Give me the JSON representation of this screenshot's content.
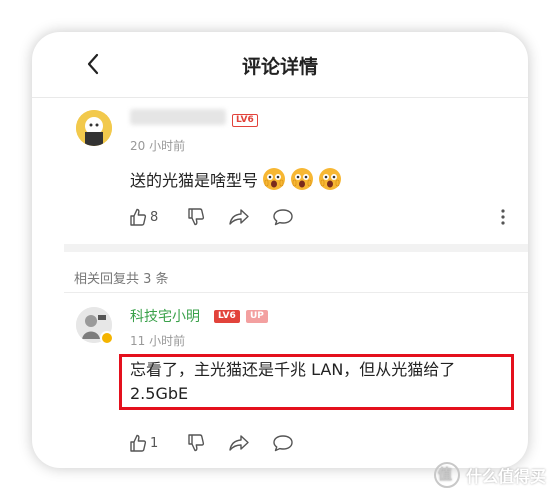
{
  "header": {
    "title": "评论详情",
    "back_icon": "chevron-left-icon"
  },
  "main_comment": {
    "level": "LV6",
    "time": "20 小时前",
    "text": "送的光猫是啥型号",
    "emoji": "astonished-face-emoji",
    "emoji_count": 3,
    "like_count": "8"
  },
  "replies_section": {
    "label": "相关回复共 3 条"
  },
  "reply": {
    "username": "科技宅小明",
    "level": "LV6",
    "up_badge": "UP",
    "time": "11 小时前",
    "text": "忘看了，主光猫还是千兆 LAN，但从光猫给了 2.5GbE",
    "like_count": "1"
  },
  "watermark": {
    "text": "什么值得买"
  },
  "colors": {
    "accent_green": "#3aa14a",
    "level_red": "#e2433b",
    "highlight_red": "#e4101d"
  }
}
